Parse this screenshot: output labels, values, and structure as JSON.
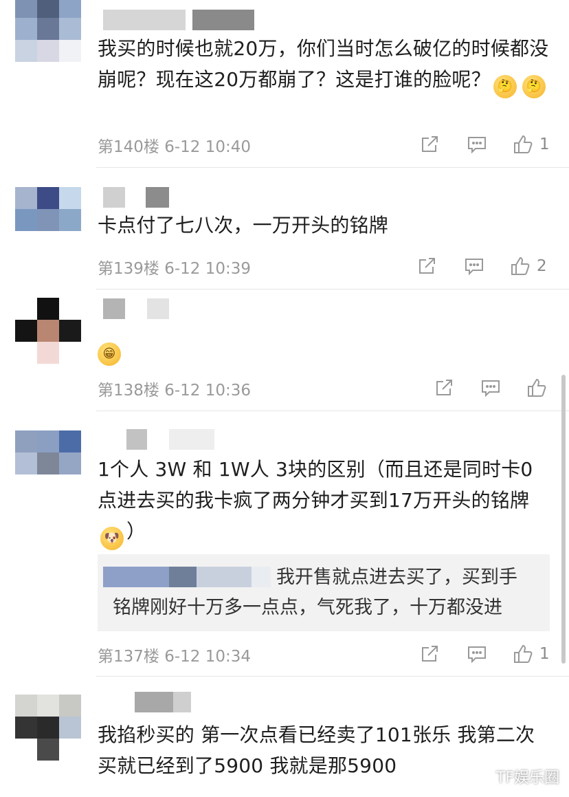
{
  "comments": [
    {
      "text": "我买的时候也就20万，你们当时怎么破亿的时候都没崩呢？现在这20万都崩了？这是打谁的脸呢？",
      "emojis": [
        "thinking-emoji",
        "thinking-emoji"
      ],
      "floor": "第140楼",
      "time": "6-12 10:40",
      "likes": "1"
    },
    {
      "text": "卡点付了七八次，一万开头的铭牌",
      "floor": "第139楼",
      "time": "6-12 10:39",
      "likes": "2"
    },
    {
      "emojis": [
        "grin-emoji"
      ],
      "floor": "第138楼",
      "time": "6-12 10:36",
      "likes": ""
    },
    {
      "text": "1个人 3W 和 1W人 3块的区别（而且还是同时卡0点进去买的我卡疯了两分钟才买到17万开头的铭牌",
      "text_tail": "）",
      "emojis": [
        "doge-emoji"
      ],
      "quote": {
        "line1": "我开售就点进去买了，买到手",
        "line2": "铭牌刚好十万多一点点，气死我了，十万都没进"
      },
      "floor": "第137楼",
      "time": "6-12 10:34",
      "likes": "1"
    },
    {
      "text": "我掐秒买的 第一次点看已经卖了101张乐 我第二次买就已经到了5900 我就是那5900"
    }
  ],
  "watermark": "TF娱乐圈",
  "colors": {
    "text": "#1e1e1e",
    "meta": "#9a9a9a",
    "quote_bg": "#f2f2f2",
    "divider": "#e6e6e6"
  }
}
